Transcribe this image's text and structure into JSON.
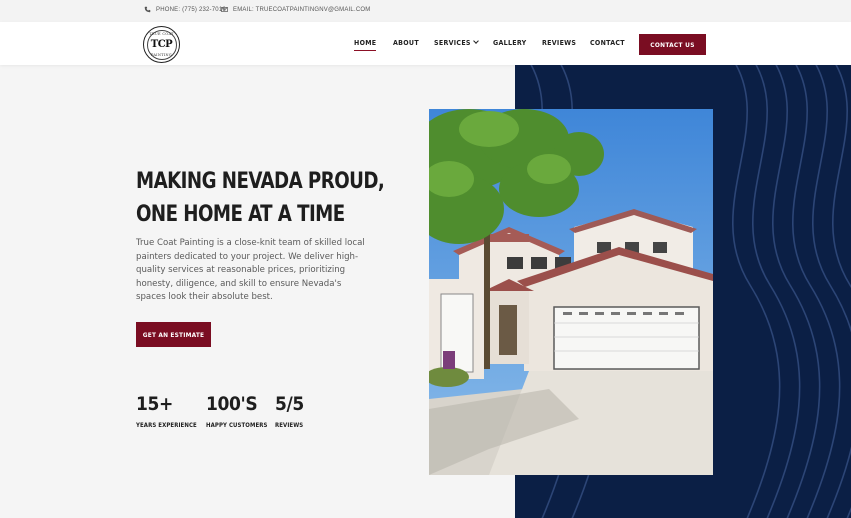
{
  "topbar": {
    "phone": "PHONE: (775) 232-7016",
    "email": "EMAIL: TRUECOATPAINTINGNV@GMAIL.COM"
  },
  "logo": {
    "monogram": "TCP",
    "top_text": "TRUE COAT",
    "bottom_text": "PAINTING"
  },
  "nav": {
    "items": [
      {
        "label": "HOME",
        "active": true
      },
      {
        "label": "ABOUT"
      },
      {
        "label": "SERVICES"
      },
      {
        "label": "GALLERY"
      },
      {
        "label": "REVIEWS"
      },
      {
        "label": "CONTACT"
      }
    ],
    "cta": "CONTACT US"
  },
  "hero": {
    "headline_line1": "MAKING NEVADA PROUD,",
    "headline_line2": "ONE HOME AT A TIME",
    "description": "True Coat Painting is a close-knit team of skilled local painters dedicated to your project. We deliver high-quality services at reasonable prices, prioritizing honesty, diligence, and skill to ensure Nevada's spaces look their absolute best.",
    "button": "GET AN ESTIMATE"
  },
  "stats": [
    {
      "value": "15+",
      "label": "YEARS EXPERIENCE"
    },
    {
      "value": "100'S",
      "label": "HAPPY CUSTOMERS"
    },
    {
      "value": "5/5",
      "label": "REVIEWS"
    }
  ],
  "colors": {
    "brand": "#7a0d22",
    "navy": "#0b1f45",
    "background": "#f5f5f5"
  },
  "icons": {
    "phone": "phone-icon",
    "email": "envelope-icon",
    "dropdown": "chevron-down-icon"
  }
}
